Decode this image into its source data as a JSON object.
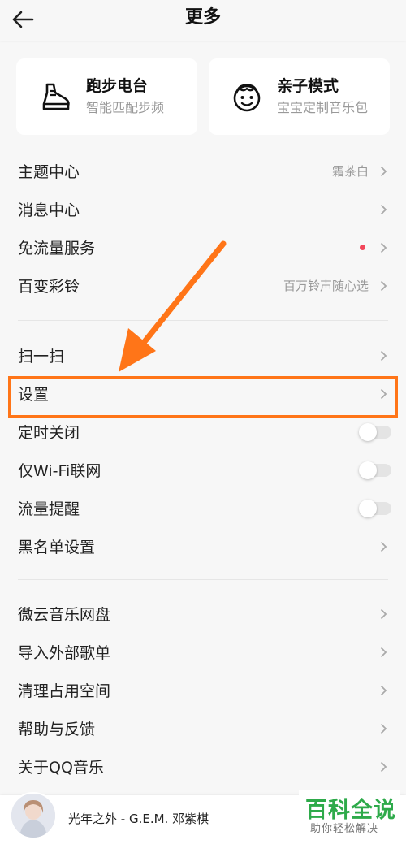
{
  "header": {
    "title": "更多"
  },
  "cards": [
    {
      "title": "跑步电台",
      "subtitle": "智能匹配步频",
      "icon": "running-shoe-icon"
    },
    {
      "title": "亲子模式",
      "subtitle": "宝宝定制音乐包",
      "icon": "baby-face-icon"
    }
  ],
  "section1": [
    {
      "label": "主题中心",
      "value": "霜茶白"
    },
    {
      "label": "消息中心"
    },
    {
      "label": "免流量服务",
      "badge": "red-dot"
    },
    {
      "label": "百变彩铃",
      "value": "百万铃声随心选"
    }
  ],
  "section2": [
    {
      "label": "扫一扫"
    },
    {
      "label": "设置"
    },
    {
      "label": "定时关闭",
      "toggle": "off"
    },
    {
      "label": "仅Wi-Fi联网",
      "toggle": "off"
    },
    {
      "label": "流量提醒",
      "toggle": "off"
    },
    {
      "label": "黑名单设置"
    }
  ],
  "section3": [
    {
      "label": "微云音乐网盘"
    },
    {
      "label": "导入外部歌单"
    },
    {
      "label": "清理占用空间"
    },
    {
      "label": "帮助与反馈"
    },
    {
      "label": "关于QQ音乐"
    }
  ],
  "player": {
    "song": "光年之外 - G.E.M. 邓紫棋"
  },
  "watermark": {
    "main": "百科全说",
    "sub": "助你轻松解决"
  },
  "colors": {
    "highlight": "#ff7518",
    "accent_dot": "#f2465a",
    "watermark": "#2eaa4a"
  }
}
